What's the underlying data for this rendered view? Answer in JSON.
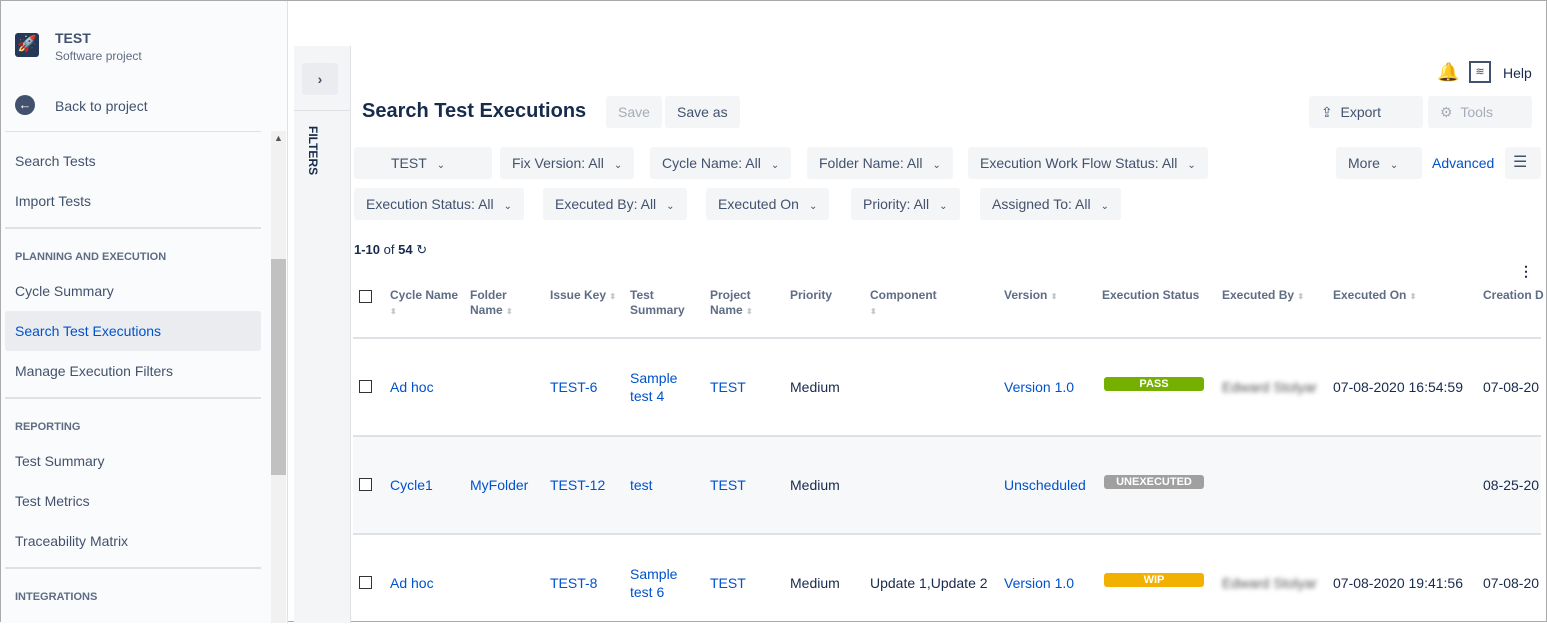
{
  "project": {
    "name": "TEST",
    "type": "Software project",
    "back": "Back to project"
  },
  "sidebar": {
    "items_top": [
      "Search Tests",
      "Import Tests"
    ],
    "sections": [
      {
        "title": "PLANNING AND EXECUTION",
        "items": [
          "Cycle Summary",
          "Search Test Executions",
          "Manage Execution Filters"
        ]
      },
      {
        "title": "REPORTING",
        "items": [
          "Test Summary",
          "Test Metrics",
          "Traceability Matrix"
        ]
      },
      {
        "title": "INTEGRATIONS",
        "items": []
      }
    ]
  },
  "filters_label": "FILTERS",
  "header": {
    "title": "Search Test Executions",
    "save": "Save",
    "save_as": "Save as",
    "export": "Export",
    "tools": "Tools",
    "help": "Help",
    "more": "More",
    "advanced": "Advanced"
  },
  "filters": [
    "TEST",
    "Fix Version: All",
    "Cycle Name: All",
    "Folder Name: All",
    "Execution Work Flow Status: All",
    "Execution Status: All",
    "Executed By: All",
    "Executed On",
    "Priority: All",
    "Assigned To: All"
  ],
  "pagination": {
    "range": "1-10",
    "of": "of",
    "total": "54"
  },
  "columns": [
    "Cycle Name",
    "Folder Name",
    "Issue Key",
    "Test Summary",
    "Project Name",
    "Priority",
    "Component",
    "Version",
    "Execution Status",
    "Executed By",
    "Executed On",
    "Creation D"
  ],
  "rows": [
    {
      "cycle": "Ad hoc",
      "folder": "",
      "key": "TEST-6",
      "summary": "Sample test 4",
      "project": "TEST",
      "priority": "Medium",
      "component": "",
      "version": "Version 1.0",
      "status": "PASS",
      "status_color": "#75b000",
      "executed_by": "Edward Stolyar",
      "executed_on": "07-08-2020 16:54:59",
      "created": "07-08-20"
    },
    {
      "cycle": "Cycle1",
      "folder": "MyFolder",
      "key": "TEST-12",
      "summary": "test",
      "project": "TEST",
      "priority": "Medium",
      "component": "",
      "version": "Unscheduled",
      "status": "UNEXECUTED",
      "status_color": "#a0a0a0",
      "executed_by": "",
      "executed_on": "",
      "created": "08-25-20"
    },
    {
      "cycle": "Ad hoc",
      "folder": "",
      "key": "TEST-8",
      "summary": "Sample test 6",
      "project": "TEST",
      "priority": "Medium",
      "component": "Update 1,Update 2",
      "version": "Version 1.0",
      "status": "WIP",
      "status_color": "#f2b000",
      "executed_by": "Edward Stolyar",
      "executed_on": "07-08-2020 19:41:56",
      "created": "07-08-20"
    }
  ]
}
